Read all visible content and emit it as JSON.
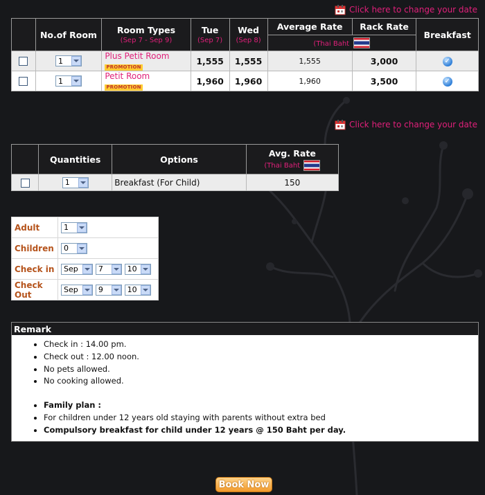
{
  "change_date_link": "Click here to change your date",
  "rooms": {
    "headers": {
      "no_of_room": "No.of Room",
      "room_types": "Room Types",
      "room_types_sub": "(Sep 7 - Sep 9)",
      "day1": "Tue",
      "day1_sub": "(Sep 7)",
      "day2": "Wed",
      "day2_sub": "(Sep 8)",
      "average_rate": "Average Rate",
      "rack_rate": "Rack Rate",
      "currency": "(Thai Baht",
      "breakfast": "Breakfast"
    },
    "rows": [
      {
        "qty": "1",
        "name": "Plus Petit Room",
        "badge": "PROMOTION",
        "tue": "1,555",
        "wed": "1,555",
        "avg": "1,555",
        "rack": "3,000"
      },
      {
        "qty": "1",
        "name": "Petit Room",
        "badge": "PROMOTION",
        "tue": "1,960",
        "wed": "1,960",
        "avg": "1,960",
        "rack": "3,500"
      }
    ]
  },
  "options": {
    "headers": {
      "quantities": "Quantities",
      "options": "Options",
      "avg_rate": "Avg. Rate",
      "currency": "(Thai Baht"
    },
    "rows": [
      {
        "qty": "1",
        "option": "Breakfast (For Child)",
        "rate": "150"
      }
    ]
  },
  "booking_form": {
    "adult_label": "Adult",
    "adult_value": "1",
    "children_label": "Children",
    "children_value": "0",
    "checkin_label": "Check in",
    "checkin_month": "Sep",
    "checkin_day": "7",
    "checkin_year": "10",
    "checkout_label": "Check Out",
    "checkout_month": "Sep",
    "checkout_day": "9",
    "checkout_year": "10"
  },
  "remark": {
    "title": "Remark",
    "items": [
      "Check in : 14.00 pm.",
      "Check out : 12.00 noon.",
      "No pets allowed.",
      "No cooking allowed.",
      "Family plan :",
      "For children under 12 years old staying with parents without extra bed",
      "Compulsory breakfast for child under 12 years @ 150 Baht per day."
    ]
  },
  "book_now": "Book Now",
  "colors": {
    "accent_pink": "#e0207a",
    "label_orange": "#b5531b",
    "header_bg": "#1b1b1d",
    "page_bg": "#17181b"
  }
}
